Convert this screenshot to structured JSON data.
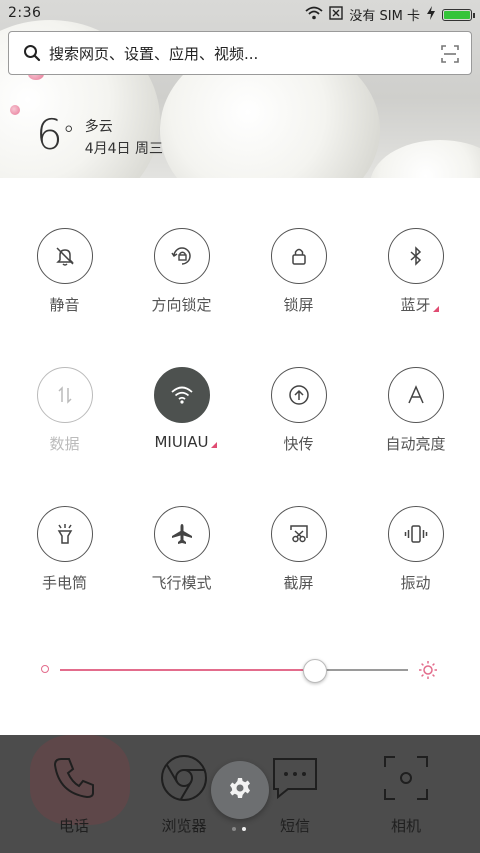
{
  "status_bar": {
    "time": "2:36",
    "carrier_text": "没有 SIM 卡",
    "battery_level": 1.0,
    "icons": [
      "wifi-icon",
      "sim-icon",
      "charging-icon",
      "battery-icon"
    ]
  },
  "search": {
    "placeholder": "搜索网页、设置、应用、视频...",
    "icons": [
      "search-icon",
      "scan-icon"
    ]
  },
  "weather": {
    "temperature": "6",
    "unit": "°",
    "condition": "多云",
    "date": "4月4日 周三"
  },
  "toggles": [
    {
      "label": "静音",
      "icon": "bell-off-icon",
      "state": "off"
    },
    {
      "label": "方向锁定",
      "icon": "rotation-lock-icon",
      "state": "off"
    },
    {
      "label": "锁屏",
      "icon": "lock-icon",
      "state": "off"
    },
    {
      "label": "蓝牙",
      "icon": "bluetooth-icon",
      "state": "off",
      "has_more": true
    },
    {
      "label": "数据",
      "icon": "data-icon",
      "state": "disabled"
    },
    {
      "label": "MIUIAU",
      "icon": "wifi-icon",
      "state": "on",
      "has_more": true
    },
    {
      "label": "快传",
      "icon": "quick-transfer-icon",
      "state": "off"
    },
    {
      "label": "自动亮度",
      "icon": "auto-brightness-icon",
      "state": "off"
    },
    {
      "label": "手电筒",
      "icon": "flashlight-icon",
      "state": "off"
    },
    {
      "label": "飞行模式",
      "icon": "airplane-icon",
      "state": "off"
    },
    {
      "label": "截屏",
      "icon": "screenshot-icon",
      "state": "off"
    },
    {
      "label": "振动",
      "icon": "vibrate-icon",
      "state": "off"
    }
  ],
  "brightness": {
    "level": 0.73,
    "icons": [
      "brightness-low-icon",
      "brightness-high-icon"
    ]
  },
  "dock": {
    "apps": [
      {
        "label": "电话",
        "icon": "phone-icon"
      },
      {
        "label": "浏览器",
        "icon": "browser-icon"
      },
      {
        "label": "短信",
        "icon": "message-icon"
      },
      {
        "label": "相机",
        "icon": "camera-icon"
      }
    ],
    "settings_icon": "gear-icon",
    "page_count": 2,
    "active_page": 2
  },
  "colors": {
    "accent": "#e36c8c",
    "toggle_on": "#4d514f",
    "battery": "#35c43a"
  }
}
